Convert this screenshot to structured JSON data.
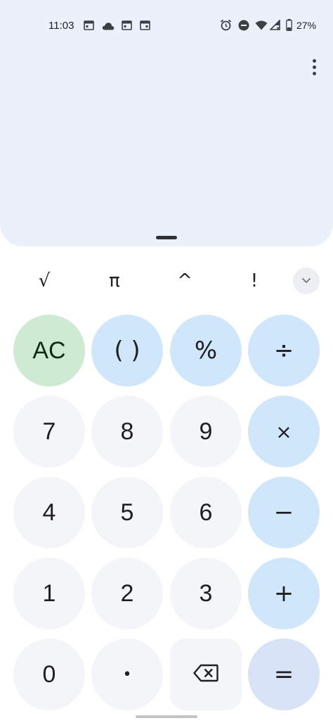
{
  "status_bar": {
    "time": "11:03",
    "left_icons": [
      "calendar-icon",
      "cloud-icon",
      "calendar-icon",
      "calendar-icon"
    ],
    "right_icons": [
      "alarm-icon",
      "do-not-disturb-icon",
      "wifi-icon",
      "signal-icon",
      "battery-icon"
    ],
    "battery": "27%"
  },
  "display": {
    "menu_icon": "more-vert-icon"
  },
  "scientific": {
    "sqrt": "√",
    "pi": "π",
    "power": "^",
    "factorial": "!",
    "expand_icon": "chevron-down-icon"
  },
  "keypad": {
    "ac": "AC",
    "parens": "( )",
    "percent": "%",
    "divide": "÷",
    "seven": "7",
    "eight": "8",
    "nine": "9",
    "multiply": "×",
    "four": "4",
    "five": "5",
    "six": "6",
    "minus": "−",
    "one": "1",
    "two": "2",
    "three": "3",
    "plus": "+",
    "zero": "0",
    "decimal": "•",
    "backspace_icon": "backspace-icon",
    "equals": "="
  },
  "colors": {
    "display_bg": "#ebf0fb",
    "number_key": "#f3f5f9",
    "operator_key": "#cfe6fb",
    "clear_key": "#cfead2",
    "equals_key": "#d8e3f8"
  }
}
